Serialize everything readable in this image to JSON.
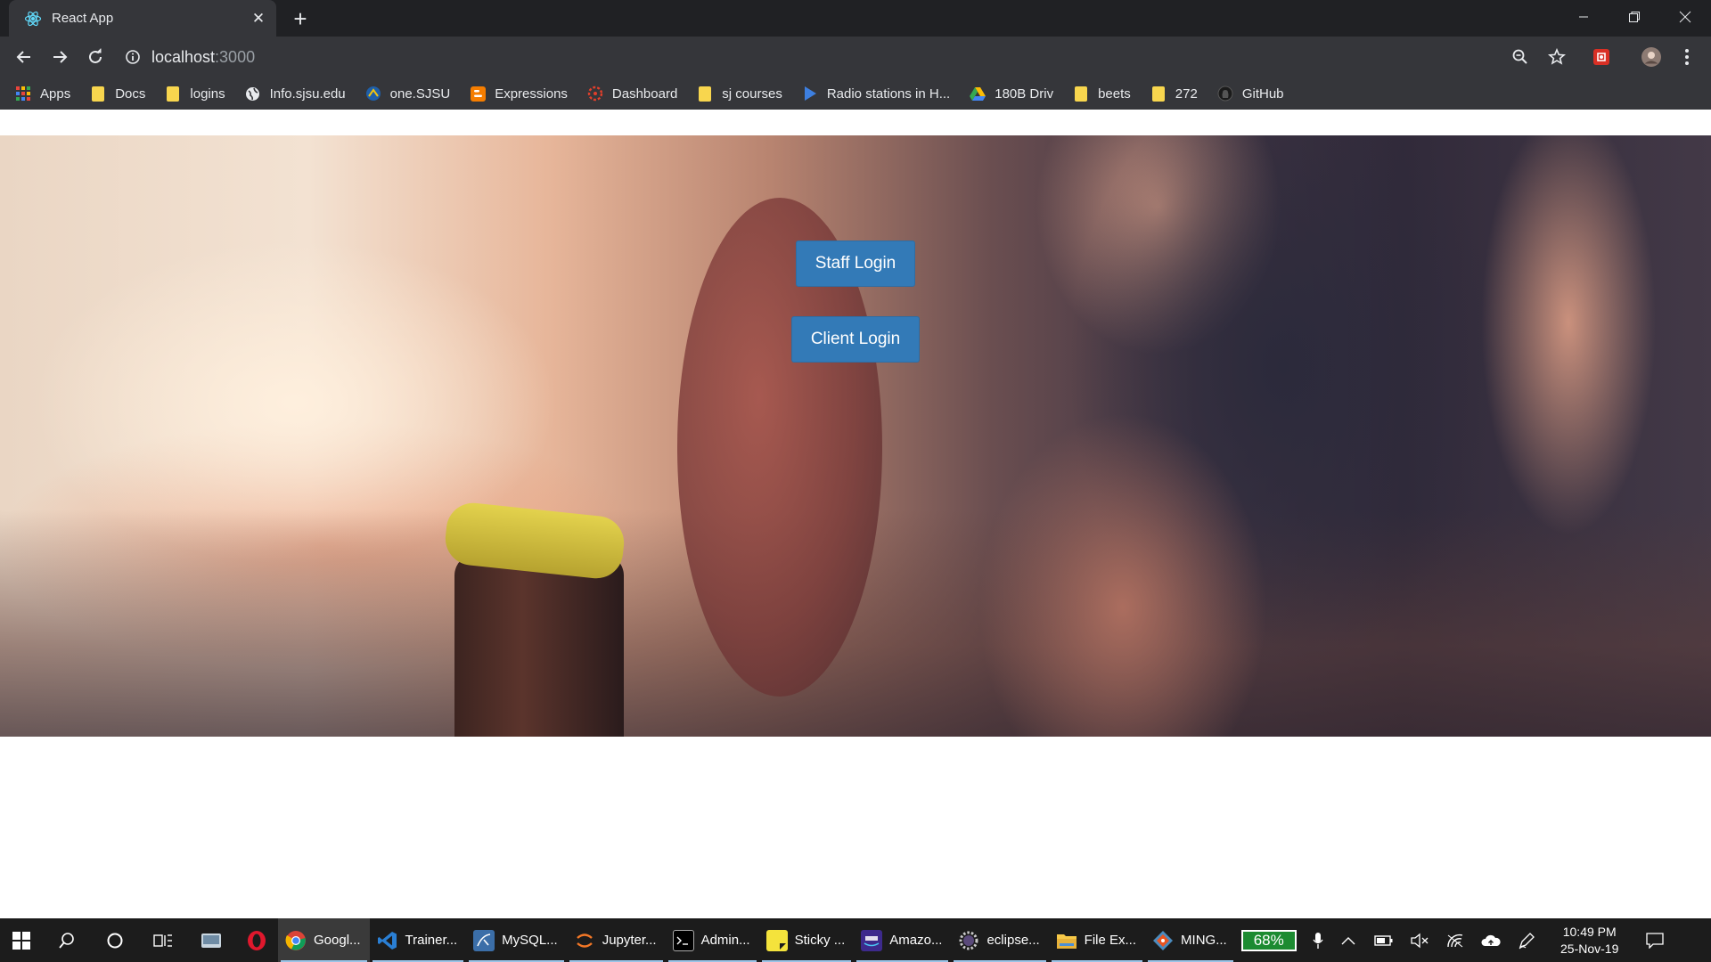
{
  "browser": {
    "tab_title": "React App",
    "url_host": "localhost",
    "url_port": ":3000",
    "icons": [
      "react-icon",
      "close-icon",
      "plus-icon",
      "minimize-icon",
      "restore-icon",
      "back-icon",
      "forward-icon",
      "reload-icon",
      "info-icon",
      "zoom-icon",
      "star-icon",
      "extension-icon",
      "profile-icon",
      "menu-icon"
    ]
  },
  "bookmarks": [
    {
      "label": "Apps",
      "icon": "apps-grid"
    },
    {
      "label": "Docs",
      "icon": "folder"
    },
    {
      "label": "logins",
      "icon": "folder"
    },
    {
      "label": "Info.sjsu.edu",
      "icon": "globe"
    },
    {
      "label": "one.SJSU",
      "icon": "sjsu"
    },
    {
      "label": "Expressions",
      "icon": "blogger"
    },
    {
      "label": "Dashboard",
      "icon": "canvas"
    },
    {
      "label": "sj courses",
      "icon": "folder"
    },
    {
      "label": "Radio stations in H...",
      "icon": "play"
    },
    {
      "label": "180B Driv",
      "icon": "drive"
    },
    {
      "label": "beets",
      "icon": "folder"
    },
    {
      "label": "272",
      "icon": "folder"
    },
    {
      "label": "GitHub",
      "icon": "github"
    }
  ],
  "page": {
    "staff_login": "Staff Login",
    "client_login": "Client Login",
    "brand_color": "#337ab7"
  },
  "taskbar": {
    "apps": [
      {
        "label": "Googl...",
        "icon": "chrome",
        "color": "#e0453a",
        "active": true
      },
      {
        "label": "Trainer...",
        "icon": "vscode",
        "color": "#2a7fd4"
      },
      {
        "label": "MySQL...",
        "icon": "mysql",
        "color": "#3b6ea8"
      },
      {
        "label": "Jupyter...",
        "icon": "jupyter",
        "color": "#f37726"
      },
      {
        "label": "Admin...",
        "icon": "terminal",
        "color": "#2b2b2b"
      },
      {
        "label": "Sticky ...",
        "icon": "sticky",
        "color": "#f4e33c"
      },
      {
        "label": "Amazo...",
        "icon": "amazon-music",
        "color": "#3d2a8c"
      },
      {
        "label": "eclipse...",
        "icon": "eclipse",
        "color": "#5a4a7a"
      },
      {
        "label": "File Ex...",
        "icon": "folder",
        "color": "#f7c948"
      },
      {
        "label": "MING...",
        "icon": "git",
        "color": "#4b8bbe"
      }
    ],
    "battery": "68%",
    "time": "10:49 PM",
    "date": "25-Nov-19"
  }
}
